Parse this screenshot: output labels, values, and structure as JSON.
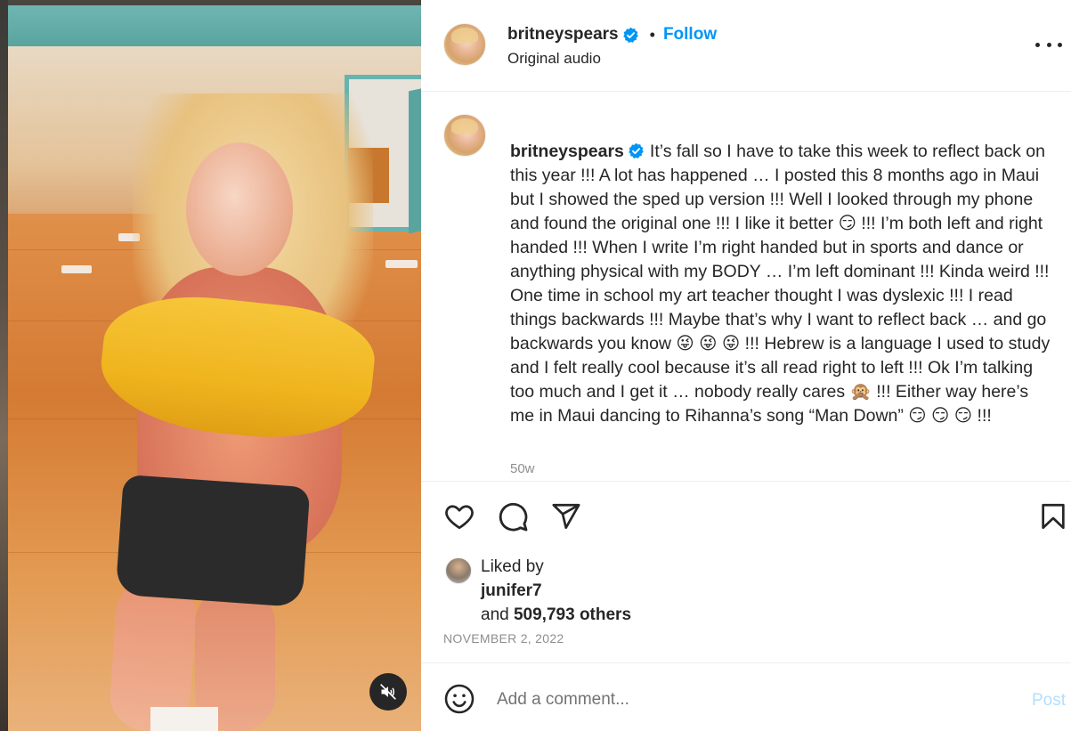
{
  "post": {
    "username": "britneyspears",
    "verified": true,
    "follow_label": "Follow",
    "separator": "•",
    "audio_label": "Original audio",
    "more_icon": "more-horizontal-icon"
  },
  "caption": {
    "username": "britneyspears",
    "text": "It’s fall so I have to take this week to reflect back on this year !!! A lot has happened … I posted this 8 months ago in Maui but I showed the sped up version !!! Well I looked through my phone and found the original one !!! I like it better 😏 !!! I’m both left and right handed !!! When I write I’m right handed but in sports and dance or anything physical with my BODY … I’m left dominant !!! Kinda weird !!! One time in school my art teacher thought I was dyslexic !!! I read things backwards !!! Maybe that’s why I want to reflect back … and go backwards you know 😜 😜 😜 !!! Hebrew is a language I used to study and I felt really cool because it’s all read right to left !!! Ok I’m talking too much and I get it … nobody really cares 🙊 !!! Either way here’s me in Maui dancing to Rihanna’s song “Man Down” 😏 😏 😏 !!!",
    "age": "50w"
  },
  "actions": {
    "like_icon": "heart-icon",
    "comment_icon": "comment-icon",
    "share_icon": "share-icon",
    "save_icon": "bookmark-icon"
  },
  "likes": {
    "liked_by_label": "Liked by",
    "liked_by_user": "junifer7",
    "and_label": "and",
    "others_count": "509,793 others"
  },
  "date": "NOVEMBER 2, 2022",
  "comment_box": {
    "placeholder": "Add a comment...",
    "post_label": "Post",
    "emoji_icon": "emoji-smile-icon"
  },
  "media": {
    "mute_icon": "muted-speaker-icon"
  },
  "colors": {
    "accent": "#0095f6",
    "text": "#262626",
    "muted": "#8e8e8e",
    "post_disabled": "#b2dffc",
    "verified_badge": "#0095f6"
  }
}
